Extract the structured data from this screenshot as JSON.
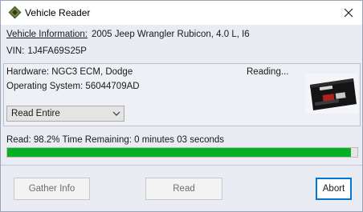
{
  "window": {
    "title": "Vehicle Reader",
    "icon": "jeep-diamond-icon",
    "close_icon": "close-icon"
  },
  "vehicle": {
    "info_label": "Vehicle Information:",
    "info_value": "2005 Jeep Wrangler Rubicon, 4.0 L, I6",
    "vin_label": "VIN:",
    "vin_value": "1J4FA69S25P"
  },
  "module": {
    "hardware": "Hardware: NGC3 ECM, Dodge",
    "operating_system": "Operating System: 56044709AD",
    "status": "Reading...",
    "read_mode": {
      "selected": "Read Entire"
    },
    "image": "ecm-module-image"
  },
  "progress": {
    "text": "Read: 98.2% Time Remaining: 0 minutes 03 seconds",
    "fraction": 0.982,
    "color": "#06b025"
  },
  "buttons": {
    "gather_info": "Gather Info",
    "read": "Read",
    "abort": "Abort"
  }
}
